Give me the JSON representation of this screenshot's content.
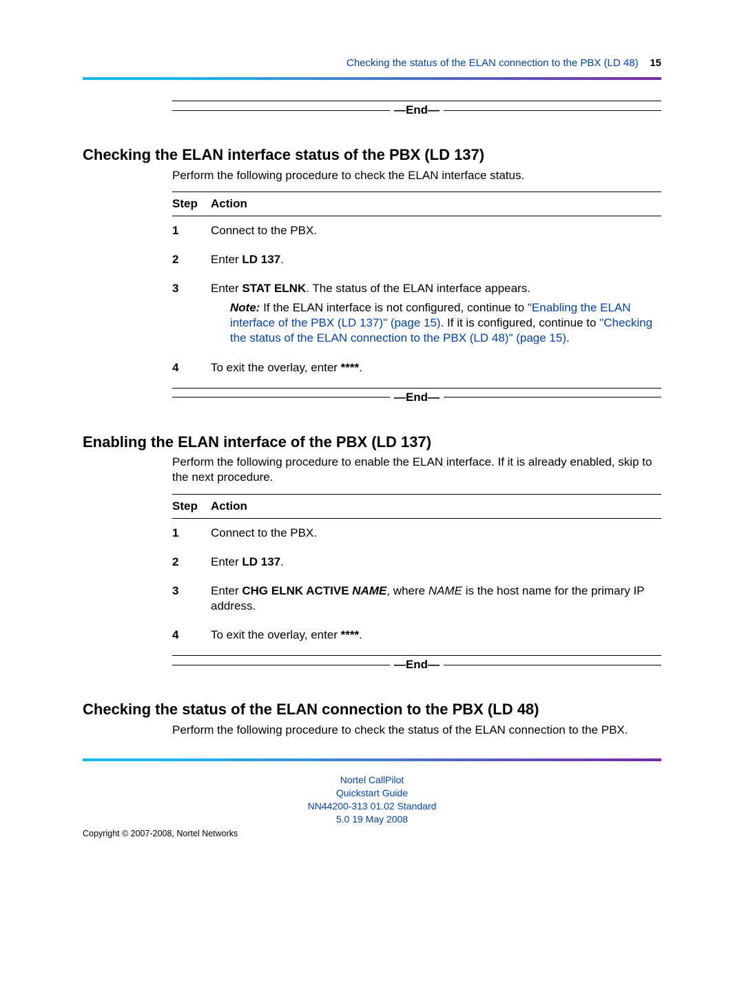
{
  "header": {
    "link_text": "Checking the status of the ELAN connection to the PBX (LD 48)",
    "page_number": "15"
  },
  "end_marker": "—End—",
  "section1": {
    "heading": "Checking the ELAN interface status of the PBX (LD 137)",
    "intro": "Perform the following procedure to check the ELAN interface status.",
    "col_step": "Step",
    "col_action": "Action",
    "step1": {
      "num": "1",
      "text": "Connect to the PBX."
    },
    "step2": {
      "num": "2",
      "text_pre": "Enter ",
      "cmd": "LD 137",
      "text_post": "."
    },
    "step3": {
      "num": "3",
      "text_pre": "Enter ",
      "cmd": "STAT ELNK",
      "text_post": ". The status of the ELAN interface appears.",
      "note_label": "Note:",
      "note_a": " If the ELAN interface is not configured, continue to ",
      "note_link1": "\"Enabling the ELAN interface of the PBX (LD 137)\" (page 15)",
      "note_b": ". If it is configured, continue to ",
      "note_link2": "\"Checking the status of the ELAN connection to the PBX (LD 48)\" (page 15)",
      "note_c": "."
    },
    "step4": {
      "num": "4",
      "text_pre": "To exit the overlay, enter ",
      "cmd": "****",
      "text_post": "."
    }
  },
  "section2": {
    "heading": "Enabling the ELAN interface of the PBX (LD 137)",
    "intro": "Perform the following procedure to enable the ELAN interface. If it is already enabled, skip to the next procedure.",
    "col_step": "Step",
    "col_action": "Action",
    "step1": {
      "num": "1",
      "text": "Connect to the PBX."
    },
    "step2": {
      "num": "2",
      "text_pre": "Enter ",
      "cmd": "LD 137",
      "text_post": "."
    },
    "step3": {
      "num": "3",
      "text_pre": "Enter ",
      "cmd1": "CHG ELNK ACTIVE ",
      "var1": "NAME",
      "mid": ", where ",
      "var2": "NAME",
      "tail": " is the host name for the primary IP address."
    },
    "step4": {
      "num": "4",
      "text_pre": "To exit the overlay, enter ",
      "cmd": "****",
      "text_post": "."
    }
  },
  "section3": {
    "heading": "Checking the status of the ELAN connection to the PBX (LD 48)",
    "intro": "Perform the following procedure to check the status of the ELAN connection to the PBX."
  },
  "footer": {
    "line1": "Nortel CallPilot",
    "line2": "Quickstart Guide",
    "line3": "NN44200-313   01.02   Standard",
    "line4": "5.0   19 May 2008",
    "copyright": "Copyright © 2007-2008, Nortel Networks"
  }
}
